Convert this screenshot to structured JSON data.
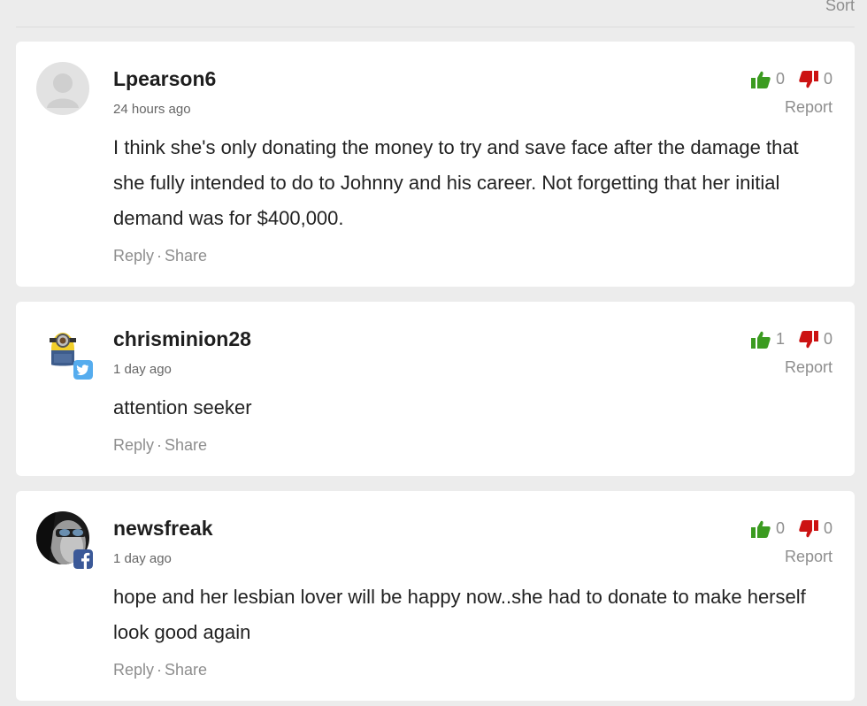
{
  "header": {
    "sort_label": "Sort"
  },
  "colors": {
    "upvote": "#3b9b20",
    "downvote": "#cc1212",
    "meta_text": "#8e8e8e",
    "twitter": "#55acee",
    "facebook": "#3b5998"
  },
  "comments": [
    {
      "username": "Lpearson6",
      "timestamp": "24 hours ago",
      "avatar_icon": "default-user-icon",
      "upvotes": "0",
      "downvotes": "0",
      "report_label": "Report",
      "text": "I think she's only donating the money to try and save face after the damage that she fully intended to do to Johnny and his career. Not forgetting that her initial demand was for $400,000.",
      "reply_label": "Reply",
      "separator": "·",
      "share_label": "Share"
    },
    {
      "username": "chrisminion28",
      "timestamp": "1 day ago",
      "avatar_icon": "minion-avatar",
      "social_icon": "twitter-icon",
      "upvotes": "1",
      "downvotes": "0",
      "report_label": "Report",
      "text": "attention seeker",
      "reply_label": "Reply",
      "separator": "·",
      "share_label": "Share"
    },
    {
      "username": "newsfreak",
      "timestamp": "1 day ago",
      "avatar_icon": "photo-avatar",
      "social_icon": "facebook-icon",
      "upvotes": "0",
      "downvotes": "0",
      "report_label": "Report",
      "text": "hope and her lesbian lover will be happy now..she had to donate to make herself look good again",
      "reply_label": "Reply",
      "separator": "·",
      "share_label": "Share"
    }
  ]
}
